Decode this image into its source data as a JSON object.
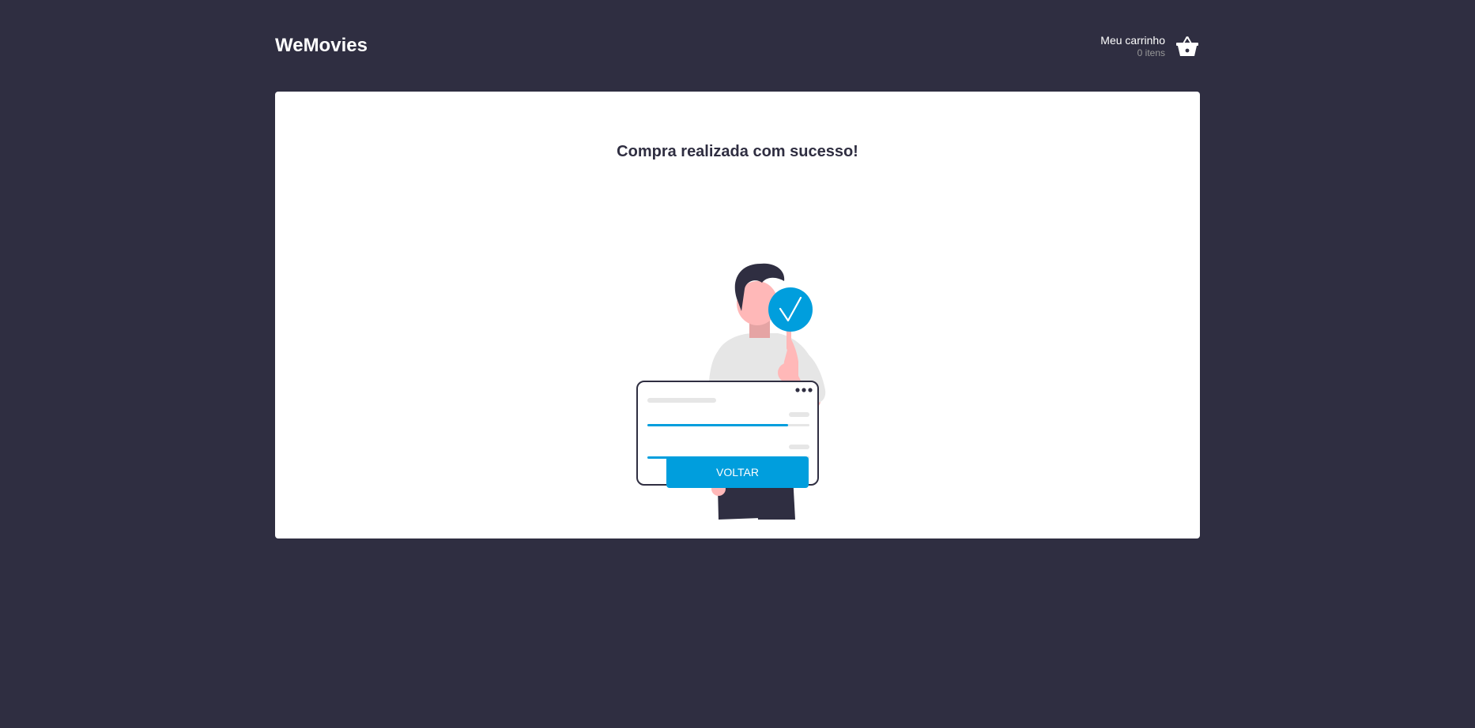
{
  "header": {
    "logo": "WeMovies",
    "cart": {
      "title": "Meu carrinho",
      "count": "0 itens",
      "icon": "basket-icon"
    }
  },
  "main": {
    "title": "Compra realizada com sucesso!",
    "illustration": {
      "icons": [
        "person-icon",
        "check-badge-icon",
        "progress-card-icon"
      ],
      "progress_bars": [
        0.87,
        0.53
      ]
    },
    "button_label": "VOLTAR"
  },
  "colors": {
    "background": "#2F2E41",
    "card": "#FFFFFF",
    "accent": "#009EDD",
    "text_dark": "#2F2E41",
    "muted": "#999999"
  }
}
